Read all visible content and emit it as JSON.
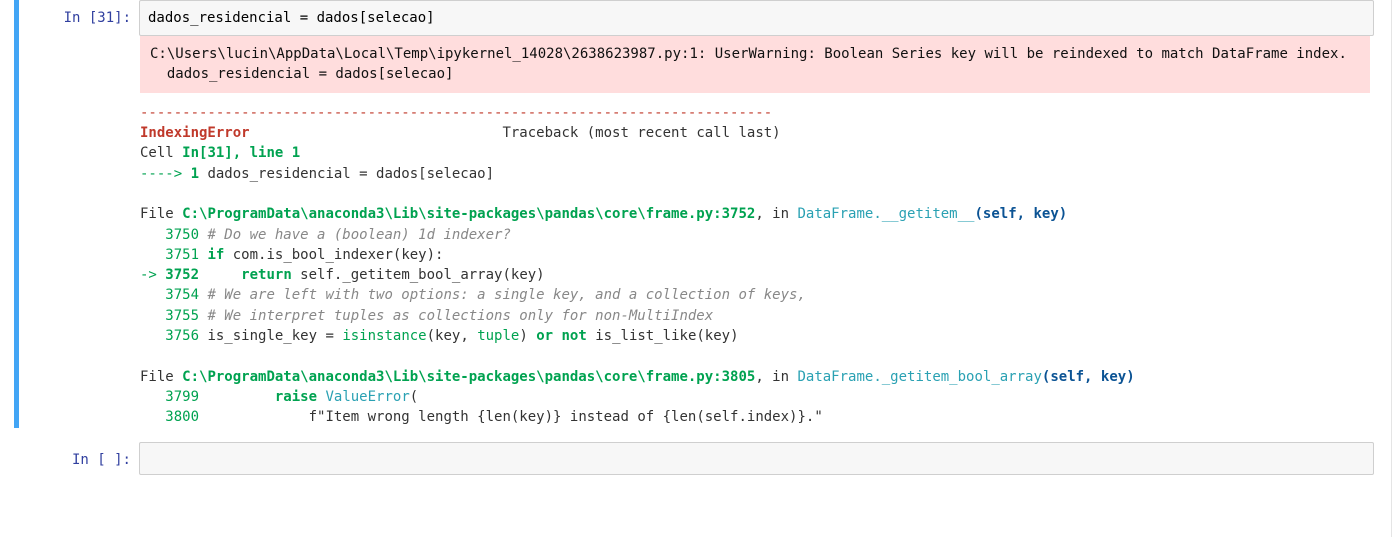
{
  "cell1": {
    "prompt": "In [31]:",
    "code": "dados_residencial = dados[selecao]",
    "warning_text": "C:\\Users\\lucin\\AppData\\Local\\Temp\\ipykernel_14028\\2638623987.py:1: UserWarning: Boolean Series key will be reindexed to match DataFrame index.\n  dados_residencial = dados[selecao]",
    "tb": {
      "sep": "---------------------------------------------------------------------------",
      "err_name": "IndexingError",
      "err_pad": "                              ",
      "tb_header": "Traceback (most recent call last)",
      "cell_line_a": "Cell ",
      "cell_line_b": "In[31], line 1",
      "arrow": "----> ",
      "one": "1",
      "user_code": " dados_residencial = dados[selecao]",
      "file1_a": "File ",
      "file1_b": "C:\\ProgramData\\anaconda3\\Lib\\site-packages\\pandas\\core\\frame.py:3752",
      "file1_c": ", in ",
      "file1_d": "DataFrame.__getitem__",
      "file1_e": "(self, key)",
      "l3750_n": "   3750",
      "l3750_t": " # Do we have a (boolean) 1d indexer?",
      "l3751_n": "   3751",
      "l3751_if": " if",
      "l3751_rest": " com.is_bool_indexer(key):",
      "l3752_arrow": "-> ",
      "l3752_n": "3752",
      "l3752_pad": "     ",
      "l3752_return": "return",
      "l3752_rest": " self._getitem_bool_array(key)",
      "l3754_n": "   3754",
      "l3754_t": " # We are left with two options: a single key, and a collection of keys,",
      "l3755_n": "   3755",
      "l3755_t": " # We interpret tuples as collections only for non-MultiIndex",
      "l3756_n": "   3756",
      "l3756_a": " is_single_key = ",
      "l3756_isinstance": "isinstance",
      "l3756_b": "(key, ",
      "l3756_tuple": "tuple",
      "l3756_c": ") ",
      "l3756_or": "or",
      "l3756_d": " ",
      "l3756_not": "not",
      "l3756_e": " is_list_like(key)",
      "file2_a": "File ",
      "file2_b": "C:\\ProgramData\\anaconda3\\Lib\\site-packages\\pandas\\core\\frame.py:3805",
      "file2_c": ", in ",
      "file2_d": "DataFrame._getitem_bool_array",
      "file2_e": "(self, key)",
      "l3799_n": "   3799",
      "l3799_pad": "         ",
      "l3799_raise": "raise",
      "l3799_sp": " ",
      "l3799_ve": "ValueError",
      "l3799_paren": "(",
      "l3800_n": "   3800",
      "l3800_pad": "             ",
      "l3800_t": "f\"Item wrong length {len(key)} instead of {len(self.index)}.\""
    }
  },
  "cell2": {
    "prompt": "In [ ]:"
  }
}
